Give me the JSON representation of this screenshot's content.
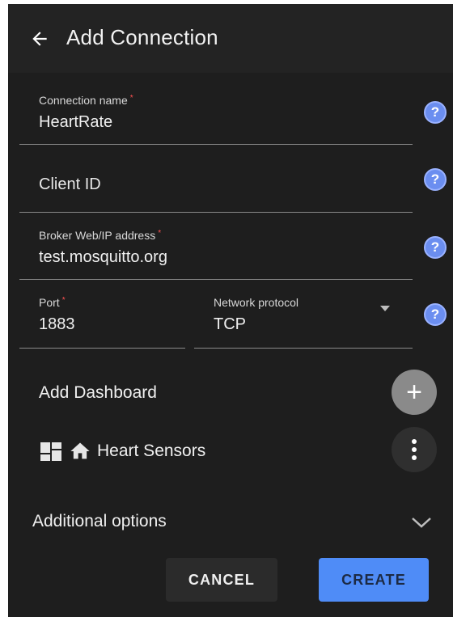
{
  "header": {
    "title": "Add Connection"
  },
  "form": {
    "connection_name": {
      "label": "Connection name",
      "required_mark": "*",
      "value": "HeartRate"
    },
    "client_id": {
      "placeholder": "Client ID"
    },
    "broker": {
      "label": "Broker Web/IP address",
      "required_mark": "*",
      "value": "test.mosquitto.org"
    },
    "port": {
      "label": "Port",
      "required_mark": "*",
      "value": "1883"
    },
    "protocol": {
      "label": "Network protocol",
      "value": "TCP"
    },
    "help_glyph": "?"
  },
  "dashboards": {
    "section_label": "Add Dashboard",
    "add_glyph": "+",
    "items": [
      {
        "name": "Heart Sensors",
        "icons": [
          "dashboard-grid-icon",
          "home-icon"
        ]
      }
    ]
  },
  "additional": {
    "label": "Additional options"
  },
  "actions": {
    "cancel_label": "CANCEL",
    "create_label": "CREATE"
  },
  "colors": {
    "background": "#1e1e1e",
    "appbar": "#232323",
    "help_icon": "#6b8ef0",
    "required": "#ff5252",
    "create_button": "#4f8cf7",
    "add_fab": "#8a8a8a"
  }
}
